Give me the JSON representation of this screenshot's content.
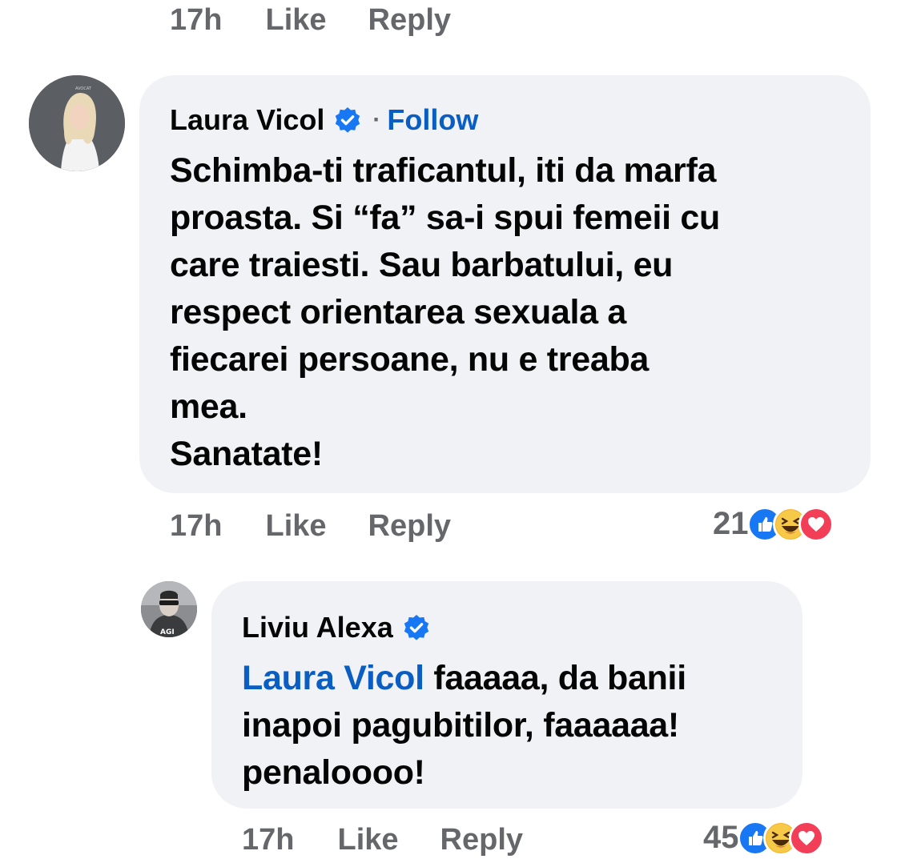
{
  "top_actions": {
    "time": "17h",
    "like": "Like",
    "reply": "Reply"
  },
  "comments": [
    {
      "author": "Laura Vicol",
      "verified": true,
      "follow_separator": "·",
      "follow_label": "Follow",
      "text_lines": [
        "Schimba-ti traficantul, iti da marfa",
        "proasta. Si “fa” sa-i spui femeii cu",
        "care traiesti. Sau barbatului, eu",
        "respect orientarea sexuala a",
        "fiecarei persoane, nu e treaba",
        "mea.",
        "Sanatate!"
      ],
      "time": "17h",
      "like": "Like",
      "reply": "Reply",
      "reaction_count": "21",
      "reaction_icons": [
        "like-icon",
        "haha-icon",
        "love-icon"
      ]
    },
    {
      "author": "Liviu Alexa",
      "verified": true,
      "mention": "Laura Vicol",
      "text_first_line_rest": " faaaaa, da banii",
      "text_lines": [
        "inapoi pagubitilor, faaaaaa!",
        "penaloooo!"
      ],
      "time": "17h",
      "like": "Like",
      "reply": "Reply",
      "reaction_count": "45",
      "reaction_icons": [
        "like-icon",
        "haha-icon",
        "love-icon"
      ]
    }
  ],
  "colors": {
    "bubble": "#f0f2f5",
    "link_blue": "#0a5dc2",
    "verified_blue": "#1877f2",
    "meta_gray": "#65676b",
    "love_red": "#f33e58",
    "haha_yellow": "#f7b125"
  }
}
